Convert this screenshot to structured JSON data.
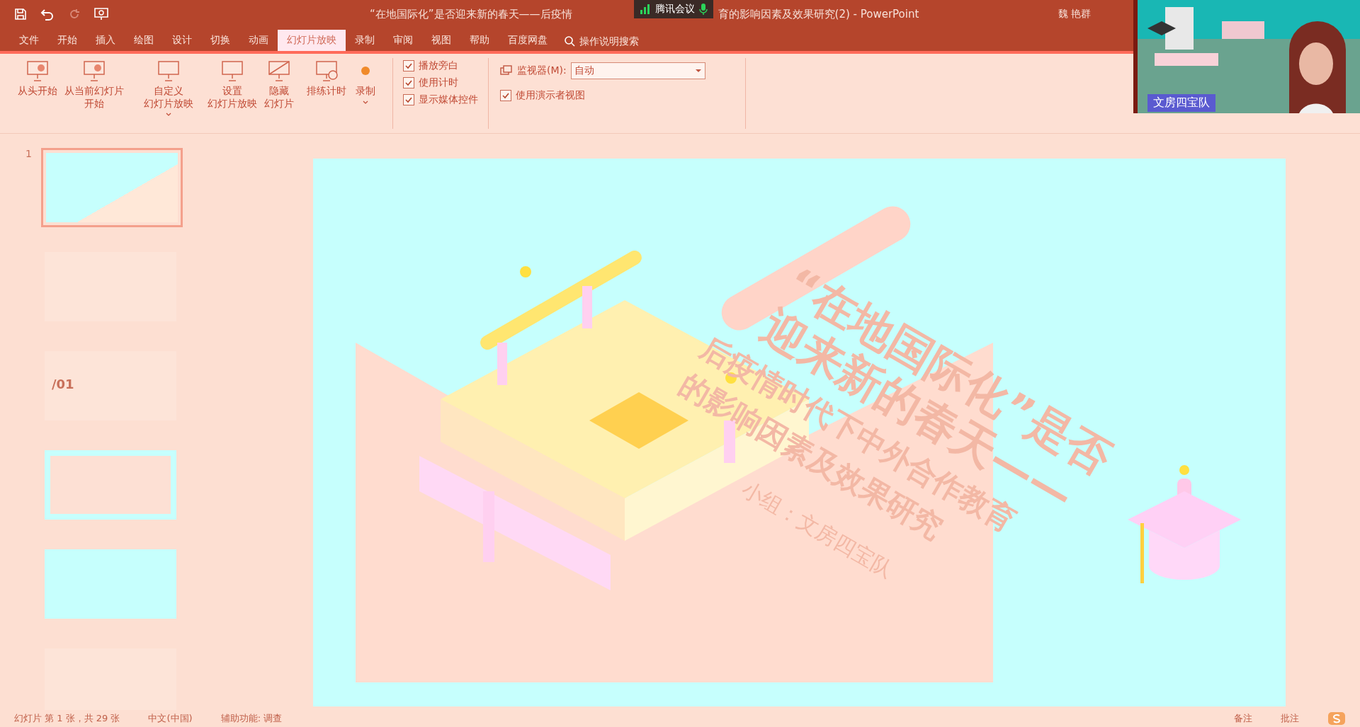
{
  "title_bar": {
    "title_left": "“在地国际化”是否迎来新的春天——后疫情",
    "title_right": "育的影响因素及效果研究(2)  -  PowerPoint",
    "user": "魏 艳群"
  },
  "meeting_badge": {
    "label": "腾讯会议"
  },
  "tabs": [
    {
      "label": "文件",
      "selected": false
    },
    {
      "label": "开始",
      "selected": false
    },
    {
      "label": "插入",
      "selected": false
    },
    {
      "label": "绘图",
      "selected": false
    },
    {
      "label": "设计",
      "selected": false
    },
    {
      "label": "切换",
      "selected": false
    },
    {
      "label": "动画",
      "selected": false
    },
    {
      "label": "幻灯片放映",
      "selected": true
    },
    {
      "label": "录制",
      "selected": false
    },
    {
      "label": "审阅",
      "selected": false
    },
    {
      "label": "视图",
      "selected": false
    },
    {
      "label": "帮助",
      "selected": false
    },
    {
      "label": "百度网盘",
      "selected": false
    }
  ],
  "search": {
    "placeholder": "操作说明搜索"
  },
  "ribbon": {
    "buttons": [
      {
        "lines": [
          "从头开始"
        ]
      },
      {
        "lines": [
          "从当前幻灯片",
          "开始"
        ]
      },
      {
        "lines": [
          "自定义",
          "幻灯片放映"
        ]
      },
      {
        "lines": [
          "设置",
          "幻灯片放映"
        ]
      },
      {
        "lines": [
          "隐藏",
          "幻灯片"
        ]
      },
      {
        "lines": [
          "排练计时"
        ]
      },
      {
        "lines": [
          "录制"
        ]
      }
    ],
    "checkboxes": [
      {
        "label": "播放旁白",
        "checked": true
      },
      {
        "label": "使用计时",
        "checked": true
      },
      {
        "label": "显示媒体控件",
        "checked": true
      }
    ],
    "monitor": {
      "label": "监视器(M):",
      "value": "自动"
    },
    "presenter_view": {
      "label": "使用演示者视图",
      "checked": true
    }
  },
  "thumbnails": [
    {
      "number": "1",
      "selected": true
    },
    {
      "selected": false
    },
    {
      "selected": false,
      "text": "/01"
    },
    {
      "selected": false
    },
    {
      "selected": false
    },
    {
      "selected": false
    }
  ],
  "slide": {
    "title_lines": [
      "“在地国际化”是否",
      "迎来新的春天——"
    ],
    "subtitle_lines": [
      "后疫情时代下中外合作教育",
      "的影响因素及效果研究"
    ],
    "team": "小组：文房四宝队"
  },
  "video": {
    "kind": "picture",
    "name": "文房四宝队"
  },
  "status_bar": {
    "left": [
      "幻灯片 第 1 张，共 29 张",
      "中文(中国)",
      "辅助功能: 调查"
    ],
    "right": [
      "备注",
      "批注"
    ]
  }
}
